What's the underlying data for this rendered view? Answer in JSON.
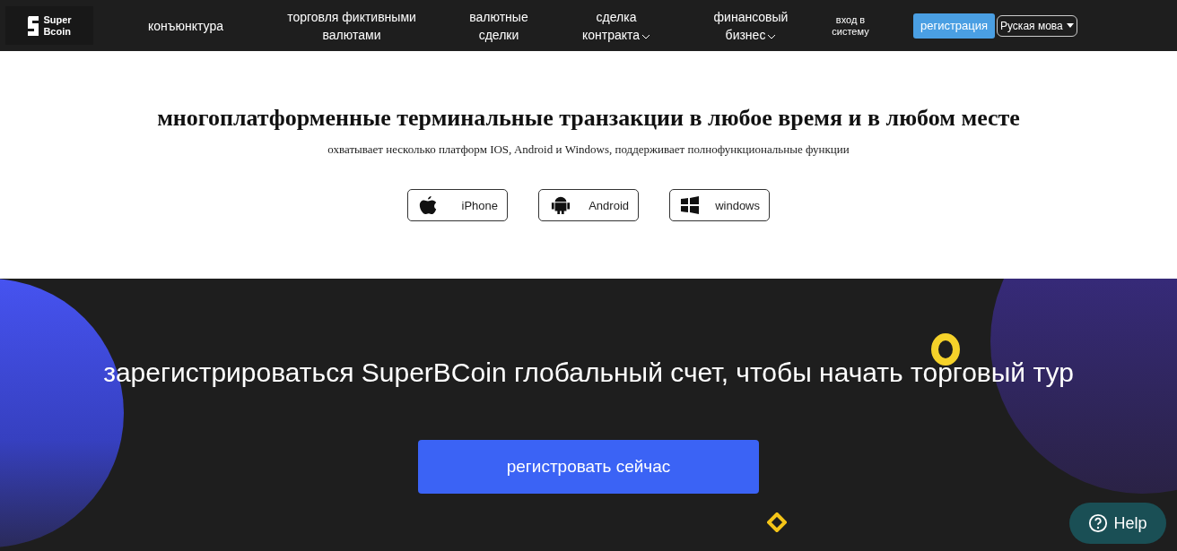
{
  "logo": {
    "line_1": "Super",
    "line_2": "Bcoin"
  },
  "nav": [
    {
      "label": "конъюнктура",
      "has_dropdown": false
    },
    {
      "label": "торговля фиктивными валютами",
      "has_dropdown": false
    },
    {
      "label": "валютные сделки",
      "has_dropdown": false
    },
    {
      "label": "сделка контракта",
      "has_dropdown": true
    },
    {
      "label": "финансовый бизнес",
      "has_dropdown": true
    }
  ],
  "login": "вход в систему",
  "register_button": "регистрация",
  "language": "Руская мова",
  "platforms": {
    "title": "многоплатформенные терминальные транзакции в любое время и в любом месте",
    "subtitle": "охватывает несколько платформ IOS, Android и Windows, поддерживает полнофункциональные функции",
    "buttons": [
      {
        "kind": "apple",
        "label": "iPhone"
      },
      {
        "kind": "android",
        "label": "Android"
      },
      {
        "kind": "windows",
        "label": "windows"
      }
    ]
  },
  "cta": {
    "title": "зарегистрироваться SuperBCoin глобальный счет, чтобы начать торговый тур",
    "button": "регистровать сейчас"
  },
  "help": "Help"
}
